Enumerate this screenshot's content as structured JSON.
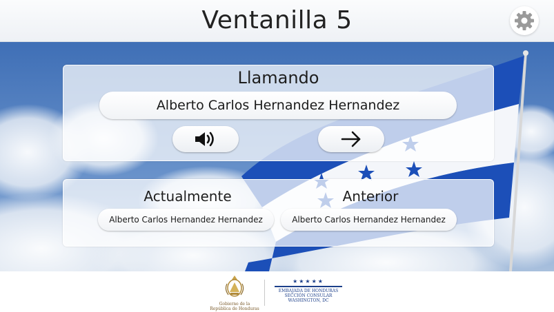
{
  "header": {
    "title": "Ventanilla 5",
    "settings_icon": "gear-icon"
  },
  "calling": {
    "heading": "Llamando",
    "name": "Alberto Carlos Hernandez Hernandez",
    "repeat_icon": "speaker-icon",
    "next_icon": "arrow-right-icon"
  },
  "status": {
    "current": {
      "heading": "Actualmente",
      "name": "Alberto Carlos Hernandez Hernandez"
    },
    "previous": {
      "heading": "Anterior",
      "name": "Alberto Carlos Hernandez Hernandez"
    }
  },
  "footer": {
    "gov_text_1": "Gobierno de la",
    "gov_text_2": "República de Honduras",
    "emb_stars": "★★★★★",
    "emb_text_1": "EMBAJADA DE HONDURAS",
    "emb_text_2": "SECCIÓN CONSULAR",
    "emb_text_3": "WASHINGTON, DC"
  },
  "colors": {
    "flag_blue": "#1c4fb8",
    "sky_blue": "#4a78bb",
    "accent_dark": "#1a1a1a"
  }
}
